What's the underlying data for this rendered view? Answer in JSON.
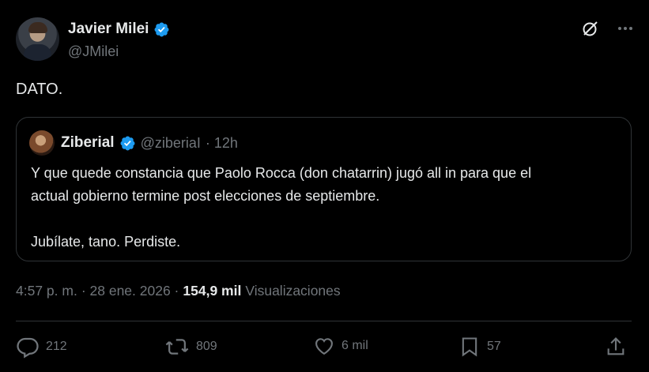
{
  "author": {
    "name": "Javier Milei",
    "handle": "@JMilei"
  },
  "tweet": {
    "text": "DATO."
  },
  "quoted": {
    "name": "Ziberial",
    "handle": "@ziberiaI",
    "time": "· 12h",
    "line1": "Y que quede constancia que Paolo Rocca (don chatarrin) jugó all in para que el",
    "line2": "actual gobierno termine post elecciones de septiembre.",
    "line3": "Jubílate, tano. Perdiste."
  },
  "meta": {
    "time": "4:57 p. m.",
    "date": "· 28 ene. 2026 ·",
    "views_count": "154,9 mil",
    "views_label": "Visualizaciones"
  },
  "actions": {
    "replies": "212",
    "reposts": "809",
    "likes": "6 mil",
    "bookmarks": "57"
  },
  "icons": {
    "verified": "verified-badge-icon",
    "grok": "grok-icon",
    "more": "more-icon",
    "reply": "reply-icon",
    "repost": "repost-icon",
    "like": "like-icon",
    "bookmark": "bookmark-icon",
    "share": "share-icon"
  },
  "colors": {
    "background": "#000000",
    "text": "#e7e9ea",
    "secondary": "#71767b",
    "border": "#2f3336",
    "verified": "#1d9bf0"
  }
}
